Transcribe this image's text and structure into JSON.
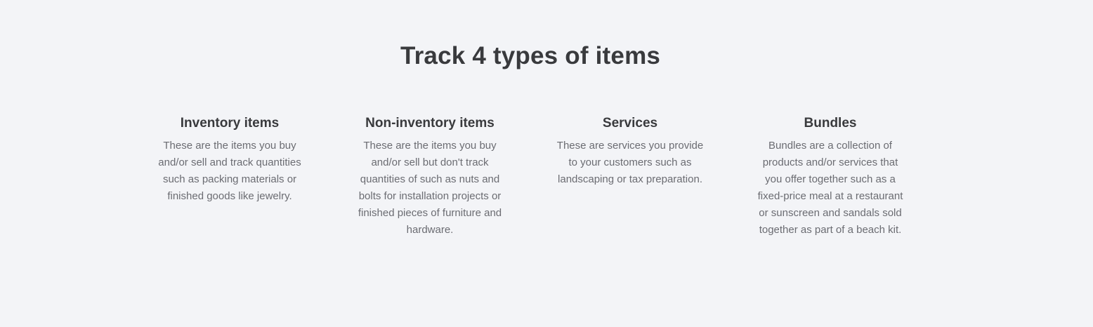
{
  "section": {
    "title": "Track 4 types of items"
  },
  "items": [
    {
      "title": "Inventory items",
      "description": "These are the items you buy and/or sell and track quantities such as packing materials or finished goods like jewelry."
    },
    {
      "title": "Non-inventory items",
      "description": "These are the items you buy and/or sell but don't track quantities of such as nuts and bolts for installation projects or finished pieces of furniture and hardware."
    },
    {
      "title": "Services",
      "description": "These are services you provide to your customers such as landscaping or tax preparation."
    },
    {
      "title": "Bundles",
      "description": "Bundles are a collection of products and/or services that you offer together such as a fixed-price meal at a restaurant or sunscreen and sandals sold together as part of a beach kit."
    }
  ]
}
